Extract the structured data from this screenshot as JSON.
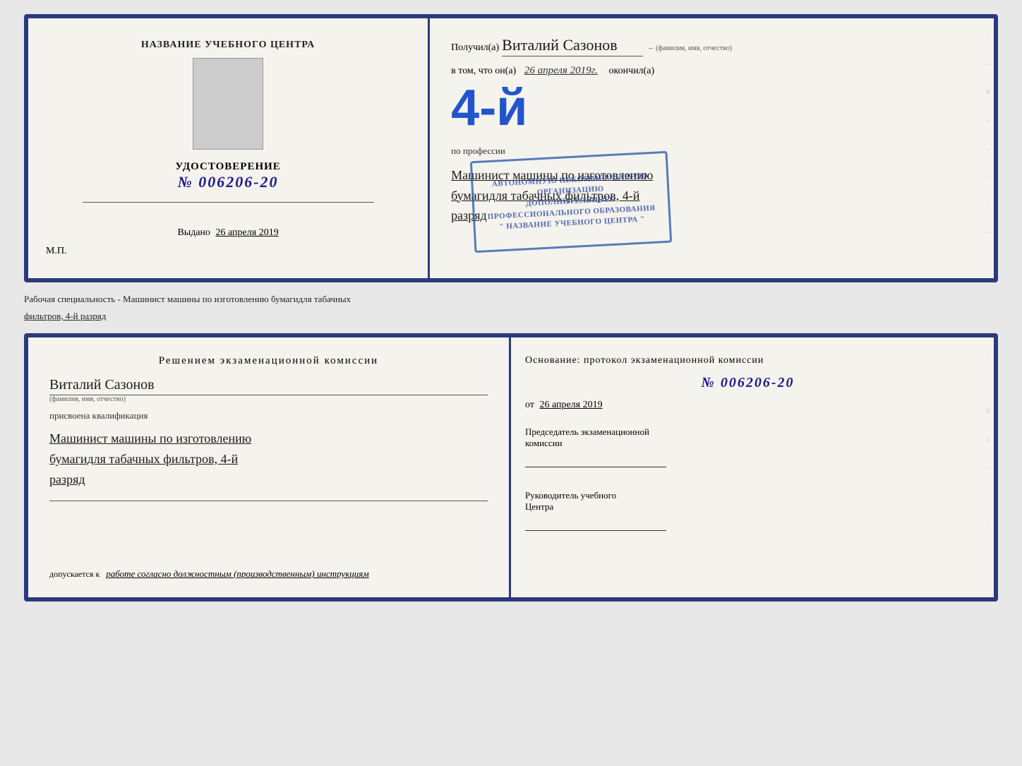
{
  "top_cert": {
    "left": {
      "title": "НАЗВАНИЕ УЧЕБНОГО ЦЕНТРА",
      "udostoverenie_label": "УДОСТОВЕРЕНИЕ",
      "number": "№ 006206-20",
      "vydano_label": "Выдано",
      "vydano_date": "26 апреля 2019",
      "mp": "М.П."
    },
    "right": {
      "poluchil_prefix": "Получил(а)",
      "recipient_name": "Виталий Сазонов",
      "fio_caption": "(фамилия, имя, отчество)",
      "v_tom_prefix": "в том, что он(а)",
      "date": "26 апреля 2019г.",
      "okonchil": "окончил(а)",
      "big_number": "4-й",
      "stamp_line1": "АВТОНОМНУЮ НЕКОММЕРЧЕСКУЮ ОРГАНИЗАЦИЮ",
      "stamp_line2": "ДОПОЛНИТЕЛЬНОГО ПРОФЕССИОНАЛЬНОГО ОБРАЗОВАНИЯ",
      "stamp_line3": "\" НАЗВАНИЕ УЧЕБНОГО ЦЕНТРА \"",
      "po_professii": "по профессии",
      "profession_line1": "Машинист машины по изготовлению",
      "profession_line2": "бумагидля табачных фильтров, 4-й",
      "profession_line3": "разряд"
    }
  },
  "separator": {
    "text1": "Рабочая специальность - Машинист машины по изготовлению бумагидля табачных",
    "text2": "фильтров, 4-й разряд"
  },
  "bottom_cert": {
    "left": {
      "resheniem_title": "Решением  экзаменационной  комиссии",
      "person_name": "Виталий Сазонов",
      "fio_caption": "(фамилия, имя, отчество)",
      "prisvoena": "присвоена квалификация",
      "qualification_line1": "Машинист машины по изготовлению",
      "qualification_line2": "бумагидля табачных фильтров, 4-й",
      "qualification_line3": "разряд",
      "dopuskaetsya_label": "допускается к",
      "dopuskaetsya_value": "работе согласно должностным (производственным) инструкциям"
    },
    "right": {
      "osnovaniye": "Основание:  протокол  экзаменационной  комиссии",
      "number": "№  006206-20",
      "ot_label": "от",
      "ot_date": "26 апреля 2019",
      "predsedatel_line1": "Председатель экзаменационной",
      "predsedatel_line2": "комиссии",
      "rukovoditel_line1": "Руководитель учебного",
      "rukovoditel_line2": "Центра"
    }
  },
  "edge_chars": [
    "И",
    "а",
    "←",
    "–",
    "–",
    "–",
    "–"
  ]
}
